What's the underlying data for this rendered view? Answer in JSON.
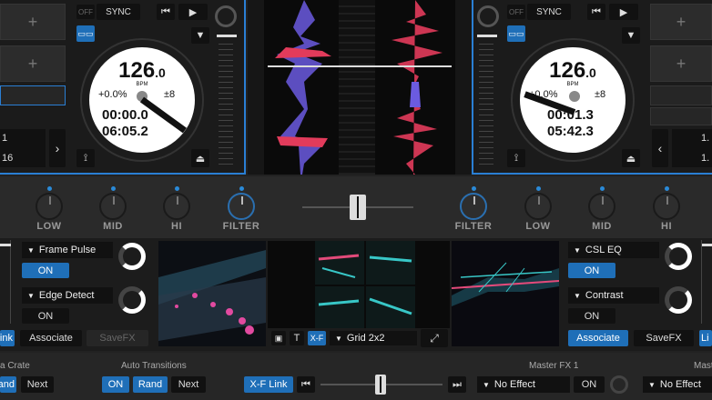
{
  "deck_left": {
    "off_label": "OFF",
    "sync_label": "SYNC",
    "bpm_int": "126",
    "bpm_dec": ".0",
    "bpm_unit": "BPM",
    "pitch": "+0.0%",
    "range": "±8",
    "elapsed": "00:00.0",
    "remaining": "06:05.2",
    "slot_plus_1": "+",
    "slot_plus_2": "+",
    "num_top": "1",
    "num_bottom": "16"
  },
  "deck_right": {
    "off_label": "OFF",
    "sync_label": "SYNC",
    "bpm_int": "126",
    "bpm_dec": ".0",
    "bpm_unit": "BPM",
    "pitch": "+0.0%",
    "range": "±8",
    "elapsed": "00:01.3",
    "remaining": "05:42.3",
    "slot_plus_1": "+",
    "slot_plus_2": "+",
    "num_top": "1.",
    "num_bottom": "1."
  },
  "eq_left": {
    "low": "LOW",
    "mid": "MID",
    "hi": "HI",
    "filter": "FILTER"
  },
  "eq_right": {
    "filter": "FILTER",
    "low": "LOW",
    "mid": "MID",
    "hi": "HI"
  },
  "fx_left": {
    "slot1": "Frame Pulse",
    "slot1_state": "ON",
    "slot2": "Edge Detect",
    "slot2_state": "ON",
    "associate": "Associate",
    "savefx": "SaveFX",
    "link": "Link"
  },
  "fx_right": {
    "slot1": "CSL EQ",
    "slot1_state": "ON",
    "slot2": "Contrast",
    "slot2_state": "ON",
    "associate": "Associate",
    "savefx": "SaveFX",
    "link": "Li"
  },
  "center_video": {
    "t_label": "T",
    "xf_label": "X-F",
    "layout": "Grid 2x2"
  },
  "bottom": {
    "crate_label": "a Crate",
    "crate_rand": "Rand",
    "crate_next": "Next",
    "auto_transitions_label": "Auto Transitions",
    "at_on": "ON",
    "at_rand": "Rand",
    "at_next": "Next",
    "xf_link": "X-F Link",
    "master_fx1_label": "Master FX 1",
    "master_fx1_effect": "No Effect",
    "master_fx1_on": "ON",
    "master_fx2_label": "Maste",
    "master_fx2_effect": "No Effect"
  },
  "colors": {
    "accent": "#1f6fb8",
    "deck_border": "#2a7fd4",
    "knob_dot": "#2a8ad8"
  }
}
